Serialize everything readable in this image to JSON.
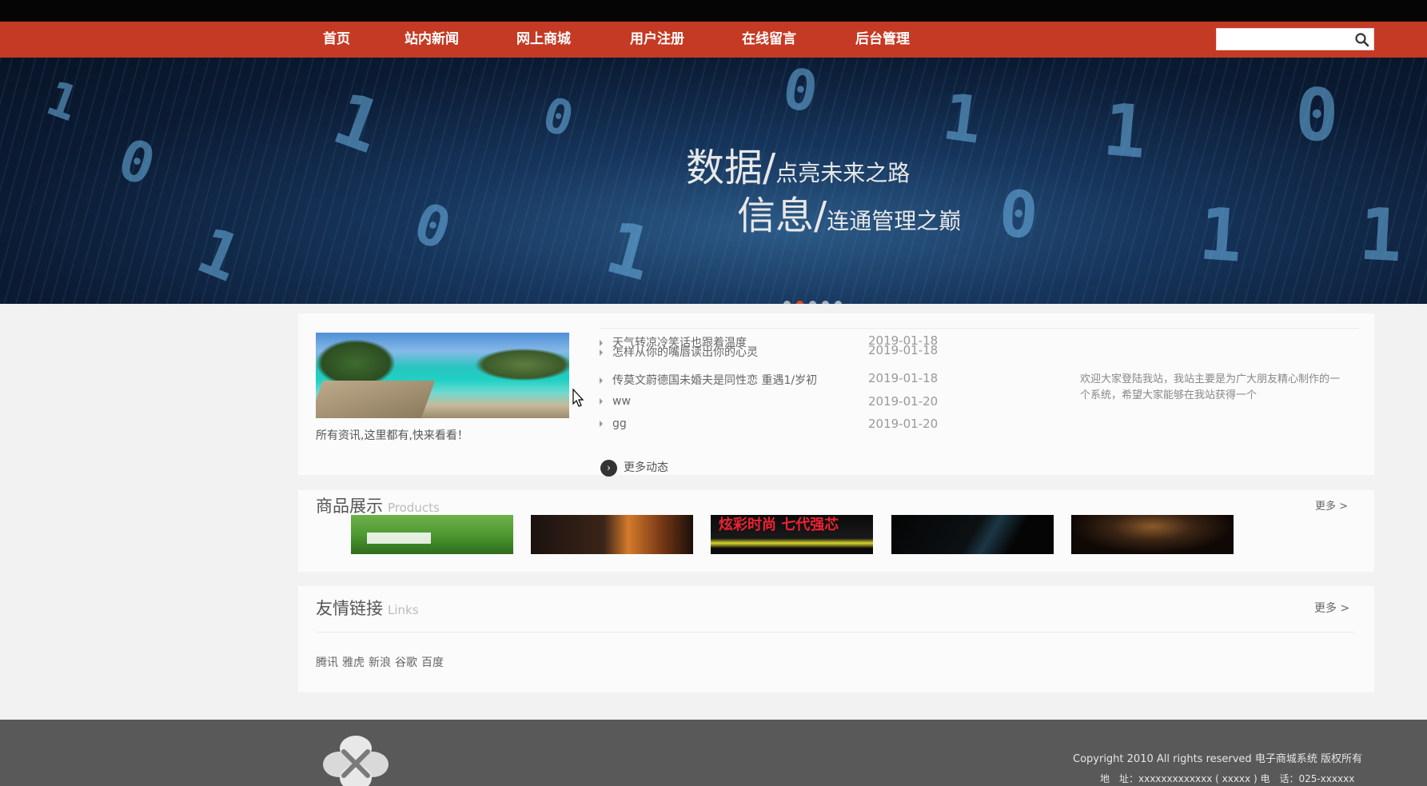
{
  "nav": {
    "items": [
      "首页",
      "站内新闻",
      "网上商城",
      "用户注册",
      "在线留言",
      "后台管理"
    ],
    "search_value": ""
  },
  "banner": {
    "line1_big": "数据/",
    "line1_small": "点亮未来之路",
    "line2_big": "信息/",
    "line2_small": "连通管理之巅"
  },
  "news": {
    "caption": "所有资讯,这里都有,快来看看！",
    "items": [
      {
        "title": "天气转凉冷笑话也跟着温度",
        "date": "2019-01-18"
      },
      {
        "title": "怎样从你的嘴唇读出你的心灵",
        "date": "2019-01-18"
      },
      {
        "title": "传莫文蔚德国未婚夫是同性恋 重遇1/岁初",
        "date": "2019-01-18"
      },
      {
        "title": "ww",
        "date": "2019-01-20"
      },
      {
        "title": "gg",
        "date": "2019-01-20"
      }
    ],
    "more_label": "更多动态",
    "welcome": "欢迎大家登陆我站，我站主要是为广大朋友精心制作的一个系统，希望大家能够在我站获得一个"
  },
  "products": {
    "title": "商品展示",
    "subtitle": "Products",
    "more": "更多 >",
    "items": [
      {
        "overlay": ""
      },
      {
        "overlay": ""
      },
      {
        "overlay": "炫彩时尚 七代强芯"
      },
      {
        "overlay": ""
      },
      {
        "overlay": ""
      }
    ]
  },
  "links": {
    "title": "友情链接",
    "subtitle": "Links",
    "more": "更多 >",
    "items": [
      "腾讯",
      "雅虎",
      "新浪",
      "谷歌",
      "百度"
    ]
  },
  "footer": {
    "copyright": "Copyright 2010 All rights reserved 电子商城系统 版权所有",
    "address": "地　址：xxxxxxxxxxxxx ( xxxxx )  电　话：025-xxxxxx"
  },
  "colors": {
    "nav_bg": "#c53a24",
    "footer_bg": "#595959",
    "page_bg": "#f2f2f2"
  }
}
